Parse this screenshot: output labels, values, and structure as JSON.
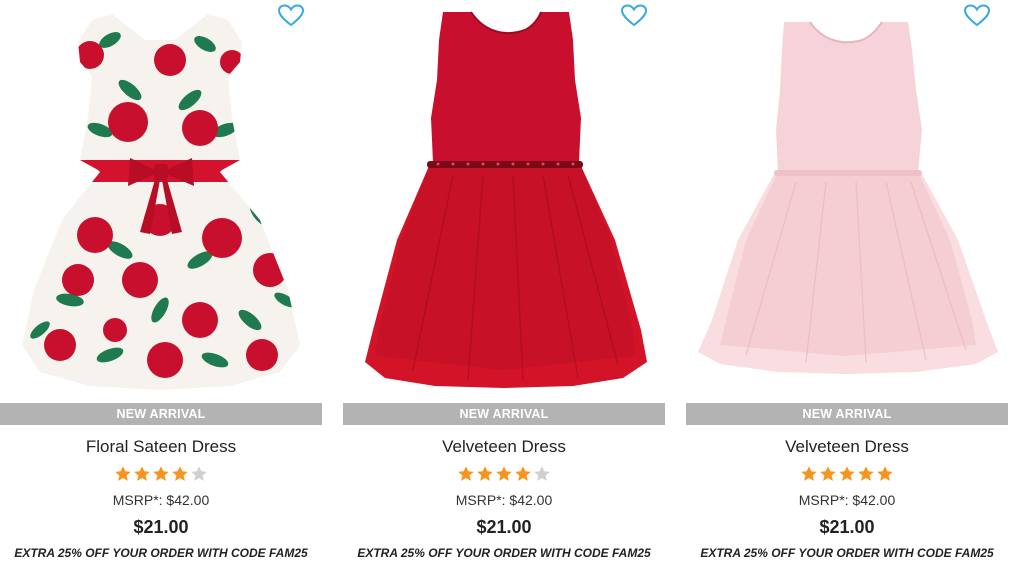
{
  "colors": {
    "badge_bg": "#b3b3b3",
    "heart": "#3aa9e0",
    "star_on": "#f7941d",
    "star_off": "#d0d0d0"
  },
  "products": [
    {
      "badge": "NEW ARRIVAL",
      "name": "Floral Sateen Dress",
      "rating": 4,
      "rating_max": 5,
      "msrp": "MSRP*: $42.00",
      "price": "$21.00",
      "promo": "EXTRA 25% OFF YOUR ORDER WITH CODE FAM25",
      "icon": "heart-outline-icon"
    },
    {
      "badge": "NEW ARRIVAL",
      "name": "Velveteen Dress",
      "rating": 4,
      "rating_max": 5,
      "msrp": "MSRP*: $42.00",
      "price": "$21.00",
      "promo": "EXTRA 25% OFF YOUR ORDER WITH CODE FAM25",
      "icon": "heart-outline-icon"
    },
    {
      "badge": "NEW ARRIVAL",
      "name": "Velveteen Dress",
      "rating": 5,
      "rating_max": 5,
      "msrp": "MSRP*: $42.00",
      "price": "$21.00",
      "promo": "EXTRA 25% OFF YOUR ORDER WITH CODE FAM25",
      "icon": "heart-outline-icon"
    }
  ]
}
